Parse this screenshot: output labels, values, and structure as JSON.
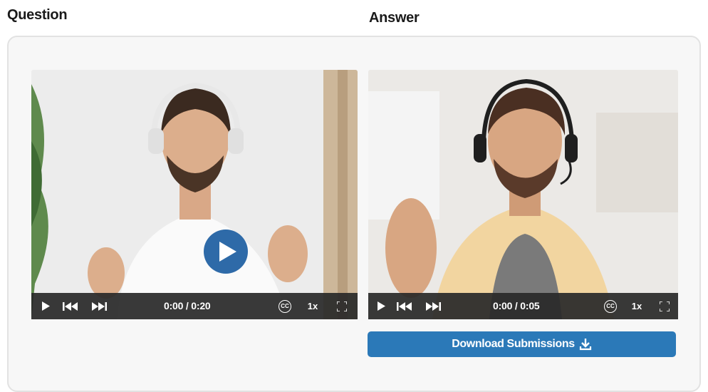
{
  "question": {
    "heading": "Question",
    "video": {
      "time_display": "0:00 / 0:20",
      "speed": "1x",
      "cc_label": "CC"
    }
  },
  "answer": {
    "heading": "Answer",
    "video": {
      "time_display": "0:00 / 0:05",
      "speed": "1x",
      "cc_label": "CC"
    },
    "download_label": "Download Submissions"
  },
  "colors": {
    "accent": "#2b79b8",
    "play_button": "#2e6aa8",
    "controls_bg": "#282828"
  }
}
